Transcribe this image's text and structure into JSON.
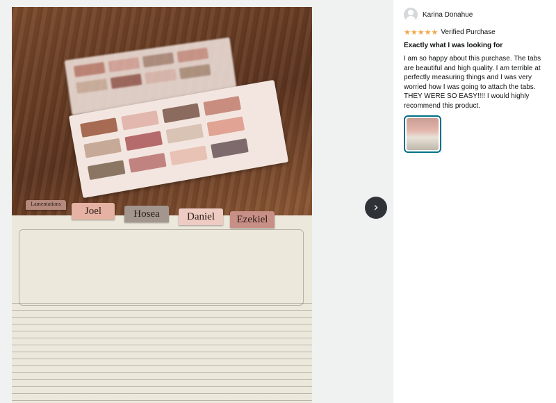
{
  "review": {
    "reviewer_name": "Karina Donahue",
    "rating_stars": 5,
    "stars_text": "★★★★★",
    "verified_label": "Verified Purchase",
    "title": "Exactly what I was looking for",
    "body": "I am so happy about this purchase. The tabs are beautiful and high quality. I am terrible at perfectly measuring things and I was very worried how I was going to attach the tabs. THEY WERE SO EASY!!!! I would highly recommend this product."
  },
  "viewer": {
    "next_icon": "chevron-right-icon",
    "next_glyph": "›",
    "photo_tabs": [
      "Lamentations",
      "Joel",
      "Hosea",
      "Daniel",
      "Ezekiel"
    ]
  },
  "colors": {
    "star": "#f3a847",
    "thumb_border": "#007185",
    "next_button": "#2f3337"
  }
}
